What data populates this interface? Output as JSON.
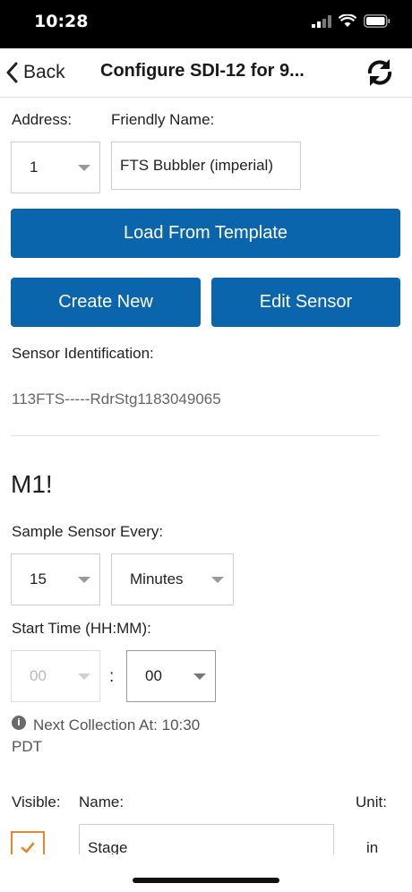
{
  "status_bar": {
    "time": "10:28"
  },
  "nav": {
    "back_label": "Back",
    "title": "Configure SDI-12 for 9..."
  },
  "form": {
    "address_label": "Address:",
    "address_value": "1",
    "friendly_name_label": "Friendly Name:",
    "friendly_name_value": "FTS Bubbler (imperial)",
    "load_template_label": "Load From Template",
    "create_new_label": "Create New",
    "edit_sensor_label": "Edit Sensor",
    "sensor_id_label": "Sensor Identification:",
    "sensor_id_value": "113FTS-----RdrStg1183049065"
  },
  "measurement": {
    "heading": "M1!",
    "sample_every_label": "Sample Sensor Every:",
    "sample_interval_value": "15",
    "sample_unit_value": "Minutes",
    "start_time_label": "Start Time (HH:MM):",
    "start_hour_value": "00",
    "time_separator": ":",
    "start_minute_value": "00",
    "next_collection_line1": "Next Collection At: 10:30",
    "next_collection_line2": "PDT"
  },
  "table": {
    "visible_header": "Visible:",
    "name_header": "Name:",
    "unit_header": "Unit:",
    "rows": [
      {
        "visible": true,
        "name": "Stage",
        "unit": "in"
      }
    ]
  },
  "colors": {
    "primary_button": "#0a65ad",
    "checkbox_accent": "#e8862b"
  },
  "icons": {
    "back": "chevron-left-icon",
    "refresh": "refresh-icon",
    "info": "info-icon",
    "dropdown": "caret-down-icon",
    "check": "checkmark-icon"
  }
}
